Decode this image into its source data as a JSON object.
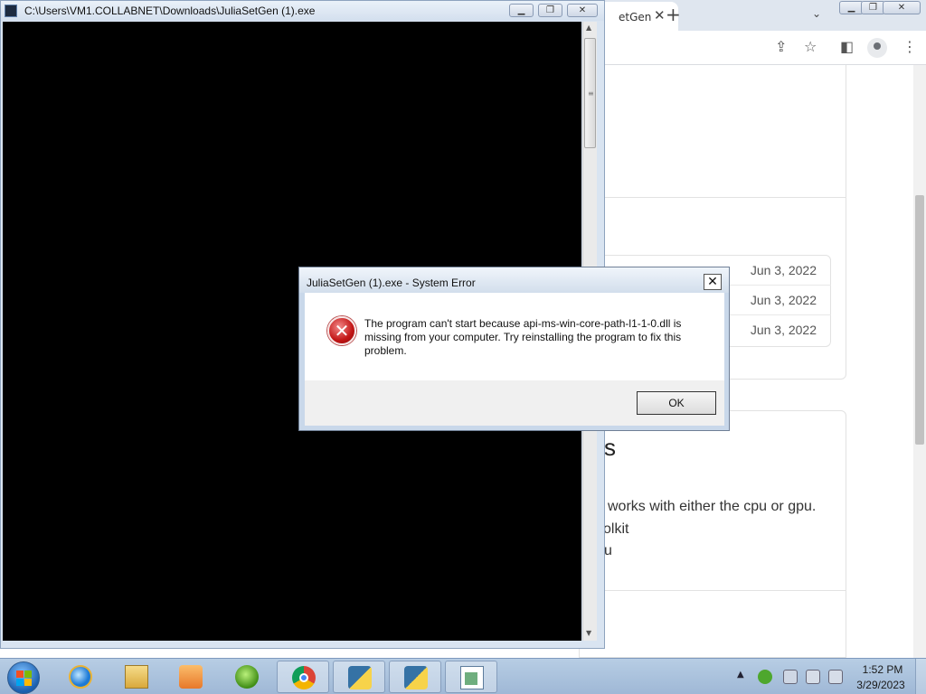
{
  "browser": {
    "tab_title": "etGen",
    "tab_close": "✕",
    "new_tab": "+",
    "tab_menu": "⌄",
    "dates": [
      "Jun 3, 2022",
      "Jun 3, 2022",
      "Jun 3, 2022"
    ],
    "section_heading": "s",
    "lines": [
      "works with either the cpu or gpu.",
      "olkit",
      "u"
    ]
  },
  "console_window": {
    "title": "C:\\Users\\VM1.COLLABNET\\Downloads\\JuliaSetGen (1).exe"
  },
  "dialog": {
    "title": "JuliaSetGen (1).exe - System Error",
    "message": "The program can't start because api-ms-win-core-path-l1-1-0.dll is missing from your computer. Try reinstalling the program to fix this problem.",
    "ok_label": "OK",
    "close_glyph": "✕"
  },
  "taskbar": {
    "time": "1:52 PM",
    "date": "3/29/2023",
    "icons": [
      "internet-explorer",
      "file-explorer",
      "media-player",
      "windows-logo",
      "chrome",
      "python",
      "python",
      "notepad"
    ]
  },
  "colors": {
    "console_bg": "#000000",
    "dialog_error": "#c21515",
    "taskbar": "#a9c1dd"
  }
}
